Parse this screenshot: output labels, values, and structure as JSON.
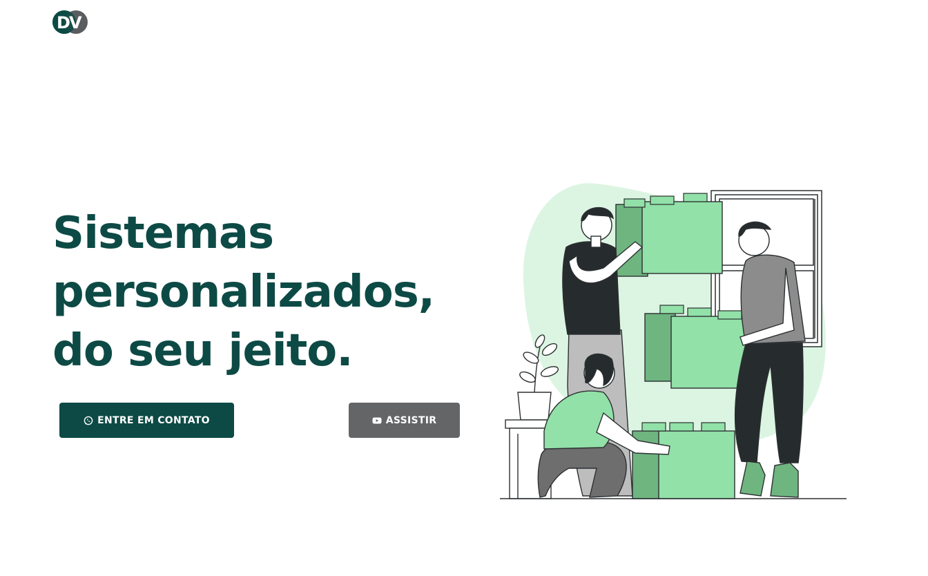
{
  "brand": {
    "logo_text": "DV",
    "primary_color": "#0d4a45",
    "secondary_color": "#636567",
    "accent_green": "#92e1a8"
  },
  "hero": {
    "headline_lines": [
      "Sistemas",
      "personalizados,",
      "do seu jeito."
    ]
  },
  "buttons": {
    "contact": {
      "label": "ENTRE EM CONTATO",
      "icon": "whatsapp-icon"
    },
    "watch": {
      "label": "ASSISTIR",
      "icon": "youtube-icon"
    }
  },
  "illustration": {
    "subject": "people-stacking-green-blocks"
  }
}
